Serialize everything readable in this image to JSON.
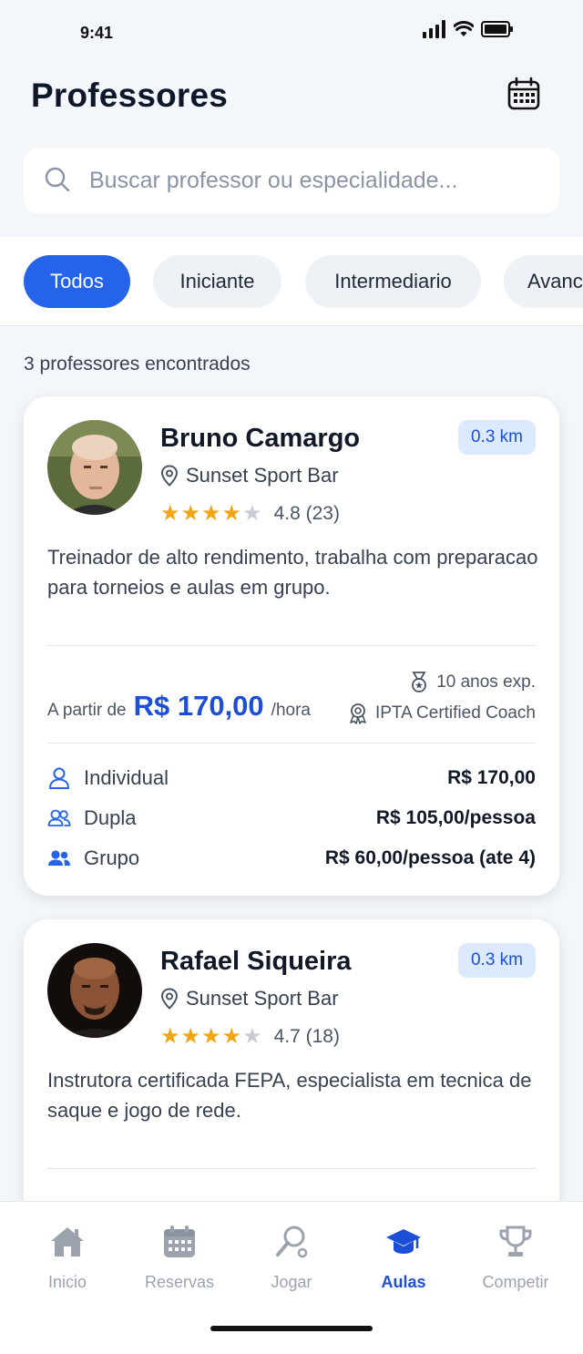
{
  "status_bar": {
    "time": "9:41"
  },
  "header": {
    "title": "Professores",
    "search_placeholder": "Buscar professor ou especialidade..."
  },
  "filters": {
    "chips": [
      {
        "label": "Todos",
        "active": true
      },
      {
        "label": "Iniciante",
        "active": false
      },
      {
        "label": "Intermediario",
        "active": false
      },
      {
        "label": "Avanc",
        "active": false
      }
    ]
  },
  "results": {
    "count_text": "3 professores encontrados"
  },
  "coaches": [
    {
      "name": "Bruno Camargo",
      "distance": "0.3 km",
      "venue": "Sunset Sport Bar",
      "rating": 4.8,
      "rating_text": "4.8 (23)",
      "bio": "Treinador de alto rendimento, trabalha com preparacao para torneios e aulas em grupo.",
      "price_prefix": "A partir de",
      "price": "R$ 170,00",
      "price_unit": "/hora",
      "experience": "10 anos exp.",
      "certification": "IPTA Certified Coach",
      "packages": [
        {
          "icon": "person-icon",
          "label": "Individual",
          "price": "R$ 170,00"
        },
        {
          "icon": "pair-icon",
          "label": "Dupla",
          "price": "R$ 105,00/pessoa"
        },
        {
          "icon": "group-icon",
          "label": "Grupo",
          "price": "R$ 60,00/pessoa (ate 4)"
        }
      ]
    },
    {
      "name": "Rafael Siqueira",
      "distance": "0.3 km",
      "venue": "Sunset Sport Bar",
      "rating": 4.7,
      "rating_text": "4.7 (18)",
      "bio": "Instrutora certificada FEPA, especialista em tecnica de saque e jogo de rede."
    }
  ],
  "bottom_nav": {
    "items": [
      {
        "label": "Inicio",
        "icon": "home-icon",
        "active": false
      },
      {
        "label": "Reservas",
        "icon": "calendar-icon",
        "active": false
      },
      {
        "label": "Jogar",
        "icon": "racket-icon",
        "active": false
      },
      {
        "label": "Aulas",
        "icon": "graduation-cap-icon",
        "active": true
      },
      {
        "label": "Competir",
        "icon": "trophy-icon",
        "active": false
      }
    ]
  },
  "colors": {
    "accent": "#2563eb",
    "star": "#f2a516",
    "background": "#f3f6fa"
  }
}
